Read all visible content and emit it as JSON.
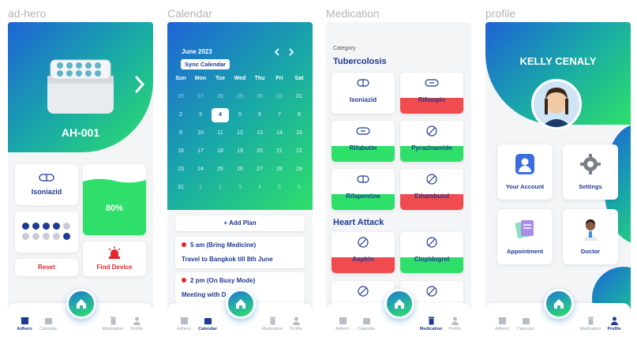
{
  "frames": {
    "ad_hero": "ad-hero",
    "calendar": "Calendar",
    "medication": "Medication",
    "profile": "profile"
  },
  "nav": {
    "adhero": "Adhero",
    "calendar": "Calendar",
    "medication": "Medication",
    "profile": "Profile"
  },
  "hero": {
    "device_name": "AH-001",
    "medicine": "Isoniazid",
    "progress_percent": 80,
    "progress_label": "80%",
    "reset": "Reset",
    "find_device": "Find Device",
    "pill_dots_filled": 6,
    "pill_dots_total": 10,
    "colors": {
      "accent": "#1f3a93",
      "danger": "#e0282e",
      "green": "#2ee06a"
    }
  },
  "calendar": {
    "month": "June 2023",
    "sync": "Sync Calendar",
    "days": [
      "Sun",
      "Mon",
      "Tue",
      "Wed",
      "Thu",
      "Fri",
      "Sat"
    ],
    "weeks": [
      [
        "26",
        "27",
        "28",
        "29",
        "30",
        "31",
        "01"
      ],
      [
        "2",
        "3",
        "4",
        "5",
        "6",
        "7",
        "8"
      ],
      [
        "9",
        "10",
        "11",
        "12",
        "13",
        "14",
        "15"
      ],
      [
        "16",
        "17",
        "18",
        "19",
        "20",
        "21",
        "22"
      ],
      [
        "23",
        "24",
        "25",
        "26",
        "27",
        "28",
        "29"
      ],
      [
        "31",
        "1",
        "2",
        "3",
        "4",
        "5",
        "6"
      ]
    ],
    "today": "4",
    "add_plan": "+ Add Plan",
    "events": [
      {
        "time": "5 am (Bring Medicine)",
        "desc": "Travel to Bangkok till 8th June"
      },
      {
        "time": "2 pm (On Busy Mode)",
        "desc": "Meeting with D"
      }
    ]
  },
  "medication": {
    "category_label": "Category",
    "groups": [
      {
        "title": "Tubercolosis",
        "items": [
          {
            "name": "Isoniazid",
            "icon": "capsule-icon",
            "status": "none"
          },
          {
            "name": "Rifampin",
            "icon": "tablet-icon",
            "status": "red"
          },
          {
            "name": "Rifabutin",
            "icon": "tablet-icon",
            "status": "green"
          },
          {
            "name": "Pyrazinamide",
            "icon": "round-pill-icon",
            "status": "green"
          },
          {
            "name": "Rifapentine",
            "icon": "capsule-icon",
            "status": "green"
          },
          {
            "name": "Ethambutol",
            "icon": "round-pill-icon",
            "status": "red"
          }
        ]
      },
      {
        "title": "Heart Attack",
        "items": [
          {
            "name": "Aspirin",
            "icon": "round-pill-icon",
            "status": "red"
          },
          {
            "name": "Clopidogrel",
            "icon": "round-pill-icon",
            "status": "green"
          }
        ]
      }
    ]
  },
  "profile": {
    "name": "KELLY CENALY",
    "menu": [
      "Your Account",
      "Settings",
      "Appointment",
      "Doctor"
    ]
  }
}
